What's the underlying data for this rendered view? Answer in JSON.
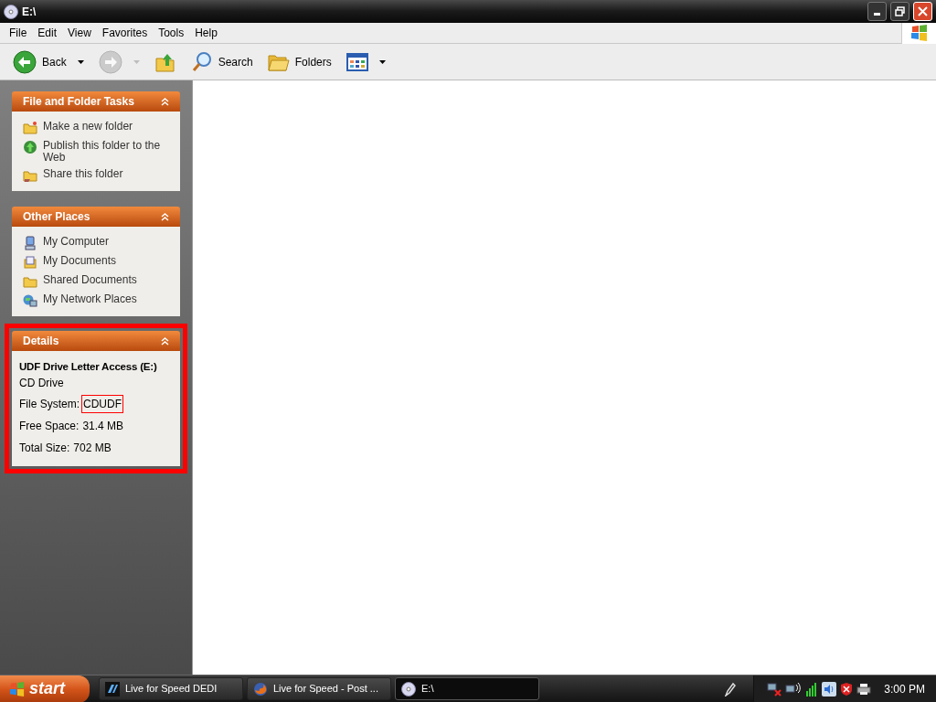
{
  "window": {
    "title": "E:\\"
  },
  "menu_bar": [
    "File",
    "Edit",
    "View",
    "Favorites",
    "Tools",
    "Help"
  ],
  "toolbar": [
    {
      "kind": "back",
      "label": "Back",
      "disabled": false
    },
    {
      "kind": "forward",
      "disabled": true
    },
    {
      "kind": "up",
      "disabled": false
    },
    {
      "kind": "search",
      "label": "Search",
      "disabled": false
    },
    {
      "kind": "folders",
      "label": "Folders",
      "disabled": false
    },
    {
      "kind": "views",
      "disabled": false
    }
  ],
  "task_panels": [
    {
      "title": "File and Folder Tasks",
      "items": [
        {
          "kind": "new-folder",
          "label": "Make a new folder"
        },
        {
          "kind": "publish",
          "label": "Publish this folder to the Web"
        },
        {
          "kind": "share",
          "label": "Share this folder"
        }
      ]
    },
    {
      "title": "Other Places",
      "items": [
        {
          "kind": "computer",
          "label": "My Computer"
        },
        {
          "kind": "documents",
          "label": "My Documents"
        },
        {
          "kind": "folder",
          "label": "Shared Documents"
        },
        {
          "kind": "network",
          "label": "My Network Places"
        }
      ]
    }
  ],
  "details": {
    "title": "Details",
    "highlighted": true,
    "name": "UDF Drive Letter Access (E:)",
    "type": "CD Drive",
    "fields": [
      {
        "label": "File System:",
        "value": "CDUDF",
        "highlighted": true
      },
      {
        "label": "Free Space:",
        "value": "31.4 MB",
        "highlighted": false
      },
      {
        "label": "Total Size:",
        "value": "702 MB",
        "highlighted": false
      }
    ]
  },
  "taskbar": {
    "start": "start",
    "tasks": [
      {
        "kind": "game",
        "label": "Live for Speed DEDI",
        "selected": false
      },
      {
        "kind": "browser",
        "label": "Live for Speed - Post ...",
        "selected": false
      },
      {
        "kind": "disc",
        "label": "E:\\",
        "selected": true
      }
    ],
    "clock": "3:00 PM"
  }
}
